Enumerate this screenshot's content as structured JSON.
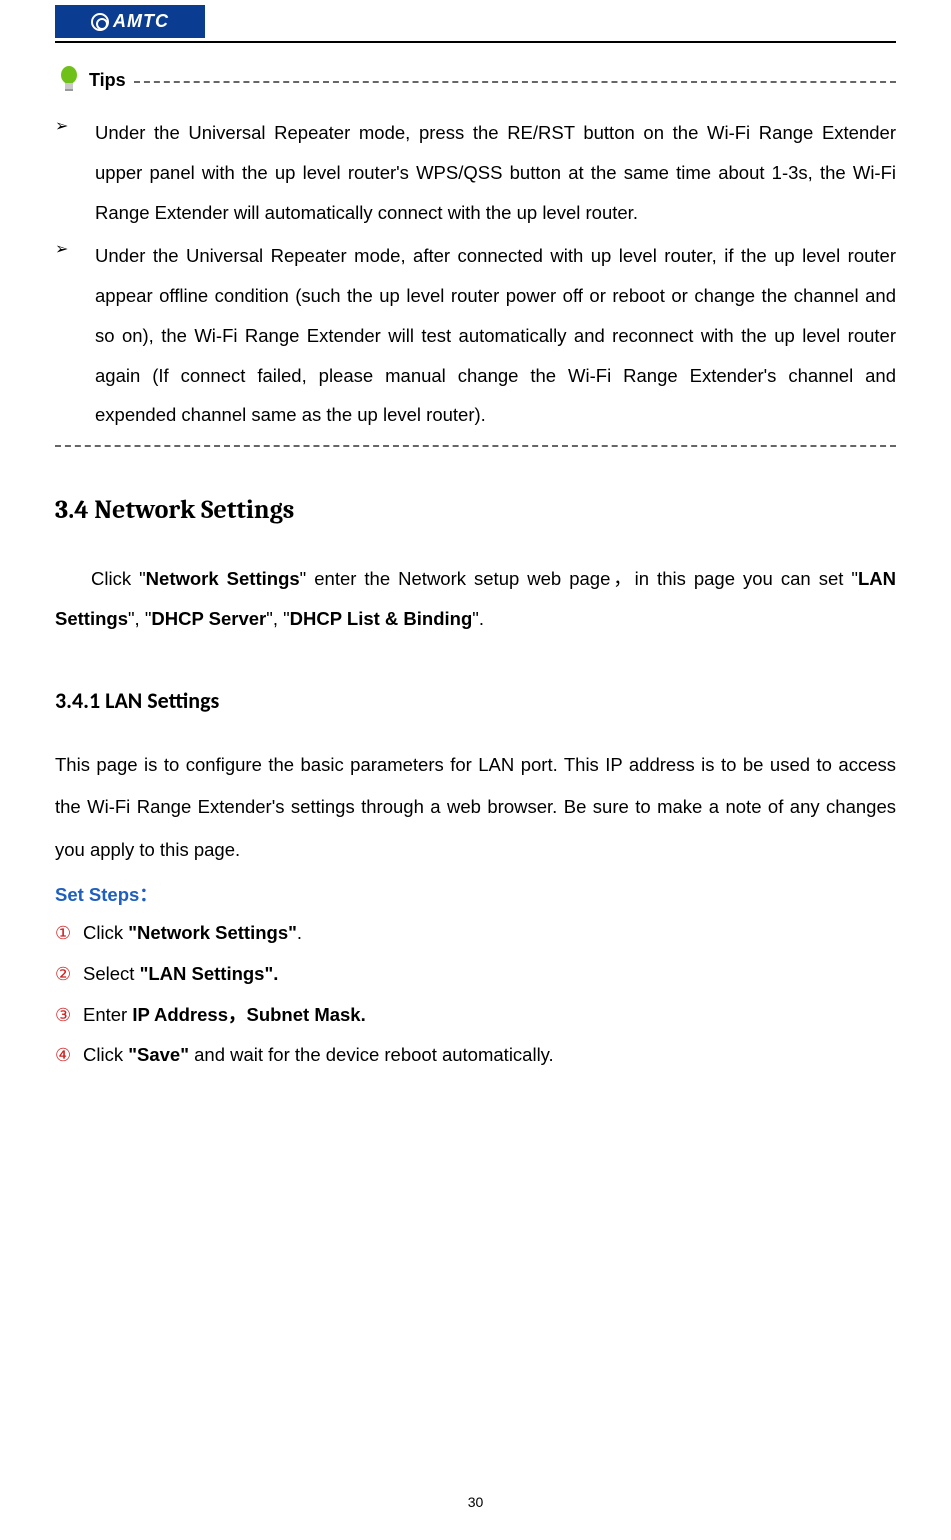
{
  "logo_text": "AMTC",
  "tips_label": "Tips",
  "tips": [
    "Under the Universal Repeater mode, press the RE/RST button on the Wi-Fi Range Extender upper panel with the up level router's WPS/QSS button at the same time about 1-3s, the Wi-Fi Range Extender will automatically connect with the up level router.",
    "Under the Universal Repeater mode, after connected with up level router, if the up level router appear offline condition (such the up level router power off or reboot or change the channel and so on), the Wi-Fi Range Extender will test automatically and reconnect with the up level router again (If connect failed, please manual change the Wi-Fi Range Extender's channel and expended channel same as the up level router)."
  ],
  "section_heading": "3.4 Network Settings",
  "section_intro": {
    "pre": "Click \"",
    "b1": "Network Settings",
    "mid1": "\" enter the Network setup web page，in this page you can set \"",
    "b2": "LAN Settings",
    "mid2": "\", \"",
    "b3": "DHCP Server",
    "mid3": "\", \"",
    "b4": "DHCP List & Binding",
    "post": "\"."
  },
  "subsection_heading": "3.4.1 LAN Settings",
  "subsection_body": "This page is to configure the basic parameters for LAN port. This IP address is to be used to access the Wi-Fi Range Extender's settings through a web browser. Be sure to make a note of any changes you apply to this page.",
  "set_steps_label": "Set Steps：",
  "steps": [
    {
      "num": "①",
      "pre": "Click ",
      "b": "\"Network Settings\"",
      "post": "."
    },
    {
      "num": "②",
      "pre": "Select ",
      "b": "\"LAN Settings\".",
      "post": ""
    },
    {
      "num": "③",
      "pre": "Enter ",
      "b": "IP Address，Subnet Mask.",
      "post": ""
    },
    {
      "num": "④",
      "pre": "Click ",
      "b": "\"Save\"",
      "post": " and wait for the device reboot automatically."
    }
  ],
  "page_number": "30"
}
